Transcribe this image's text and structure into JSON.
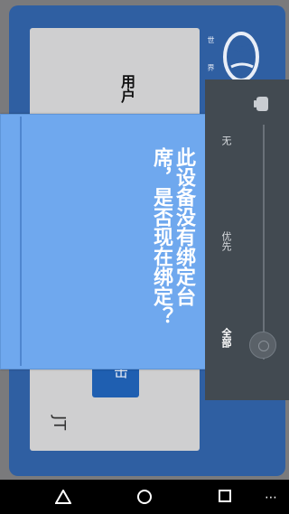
{
  "app": {
    "brand_text": "世 界",
    "user_label": "用户",
    "side_button_label": "击",
    "bottom_label": "JT"
  },
  "dialog": {
    "message": "此设备没有绑定台席，是否现在绑定？"
  },
  "notification_shade": {
    "options": [
      "无",
      "优先",
      "全部"
    ],
    "selected": "全部",
    "icon": "bell-icon"
  },
  "navbar": {
    "back": "back-icon",
    "home": "home-icon",
    "recents": "recents-icon",
    "more": "⋯"
  }
}
